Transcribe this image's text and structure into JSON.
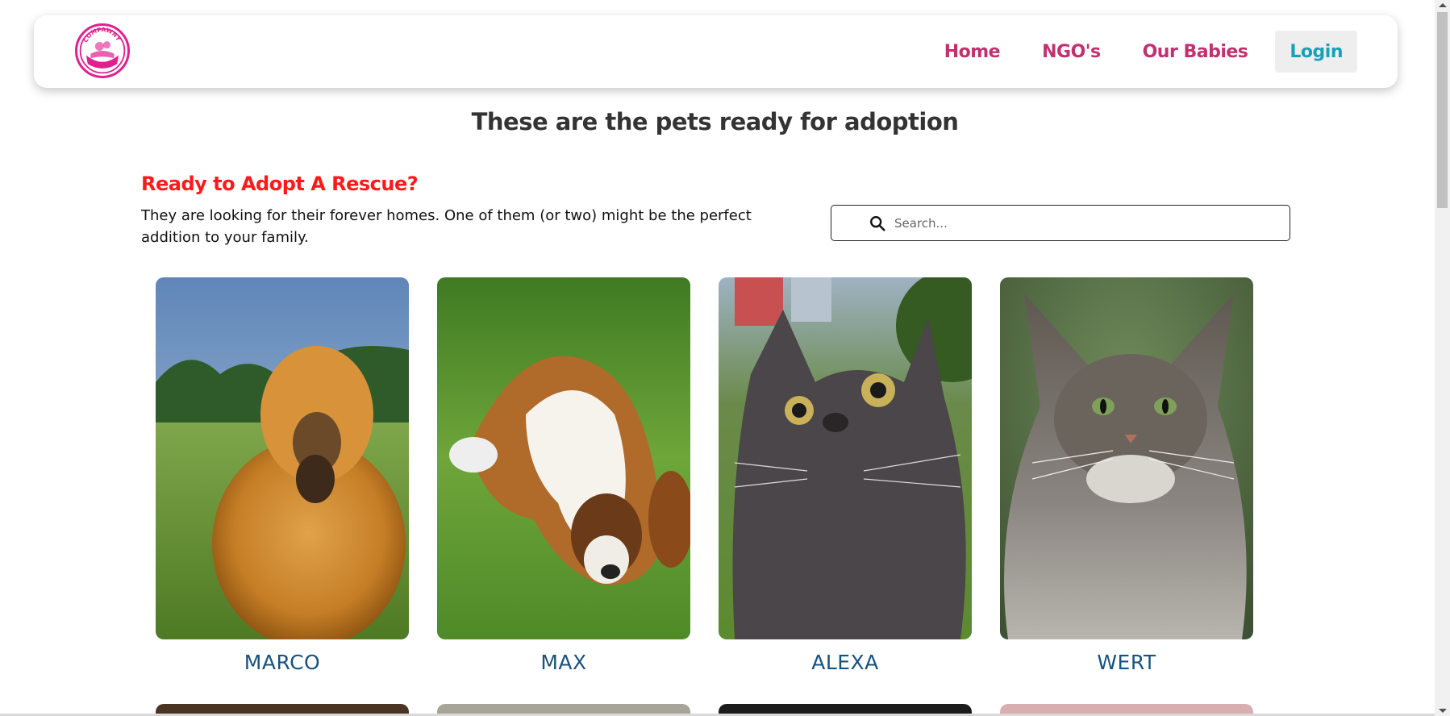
{
  "nav": {
    "logo_text": "COMPAWNY",
    "links": [
      "Home",
      "NGO's",
      "Our Babies"
    ],
    "login_label": "Login"
  },
  "page_title": "These are the pets ready for adoption",
  "cta": {
    "title": "Ready to Adopt A Rescue?",
    "text": "They are looking for their forever homes. One of them (or two) might be the perfect addition to your family."
  },
  "search": {
    "placeholder": "Search..."
  },
  "pets": [
    {
      "name": "MARCO",
      "photo": "dog-chow-chow"
    },
    {
      "name": "MAX",
      "photo": "dog-saint-bernard"
    },
    {
      "name": "ALEXA",
      "photo": "cat-grey"
    },
    {
      "name": "WERT",
      "photo": "cat-maine-coon"
    }
  ],
  "colors": {
    "nav_link": "#c2306f",
    "login": "#1aa1b8",
    "cta_title": "#ff1a1a",
    "pet_name": "#18527e",
    "logo": "#e0208f"
  }
}
